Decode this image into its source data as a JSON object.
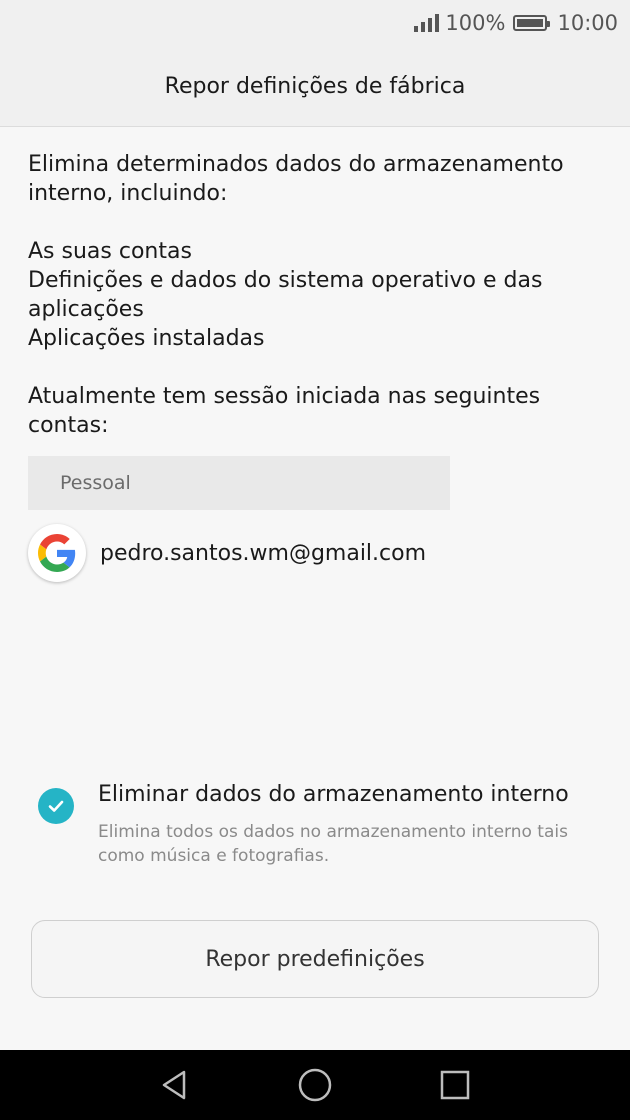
{
  "status_bar": {
    "battery_percent": "100%",
    "time": "10:00"
  },
  "header": {
    "title": "Repor definições de fábrica"
  },
  "content": {
    "intro": "Elimina determinados dados do armazenamento interno, incluindo:",
    "items": [
      "As suas contas",
      "Definições e dados do sistema operativo e das aplicações",
      "Aplicações instaladas"
    ],
    "accounts_intro": "Atualmente tem sessão iniciada nas seguintes contas:"
  },
  "accounts": {
    "section_label": "Pessoal",
    "items": [
      {
        "icon": "google-logo-icon",
        "email": "pedro.santos.wm@gmail.com"
      }
    ]
  },
  "option": {
    "checked": true,
    "title": "Eliminar dados do armazenamento interno",
    "description": "Elimina todos os dados no armazenamento interno tais como música e fotografias.",
    "check_color": "#25b4c6"
  },
  "reset_button": {
    "label": "Repor predefinições"
  },
  "nav_bar": {
    "icons": [
      "back-icon",
      "home-icon",
      "recents-icon"
    ]
  }
}
